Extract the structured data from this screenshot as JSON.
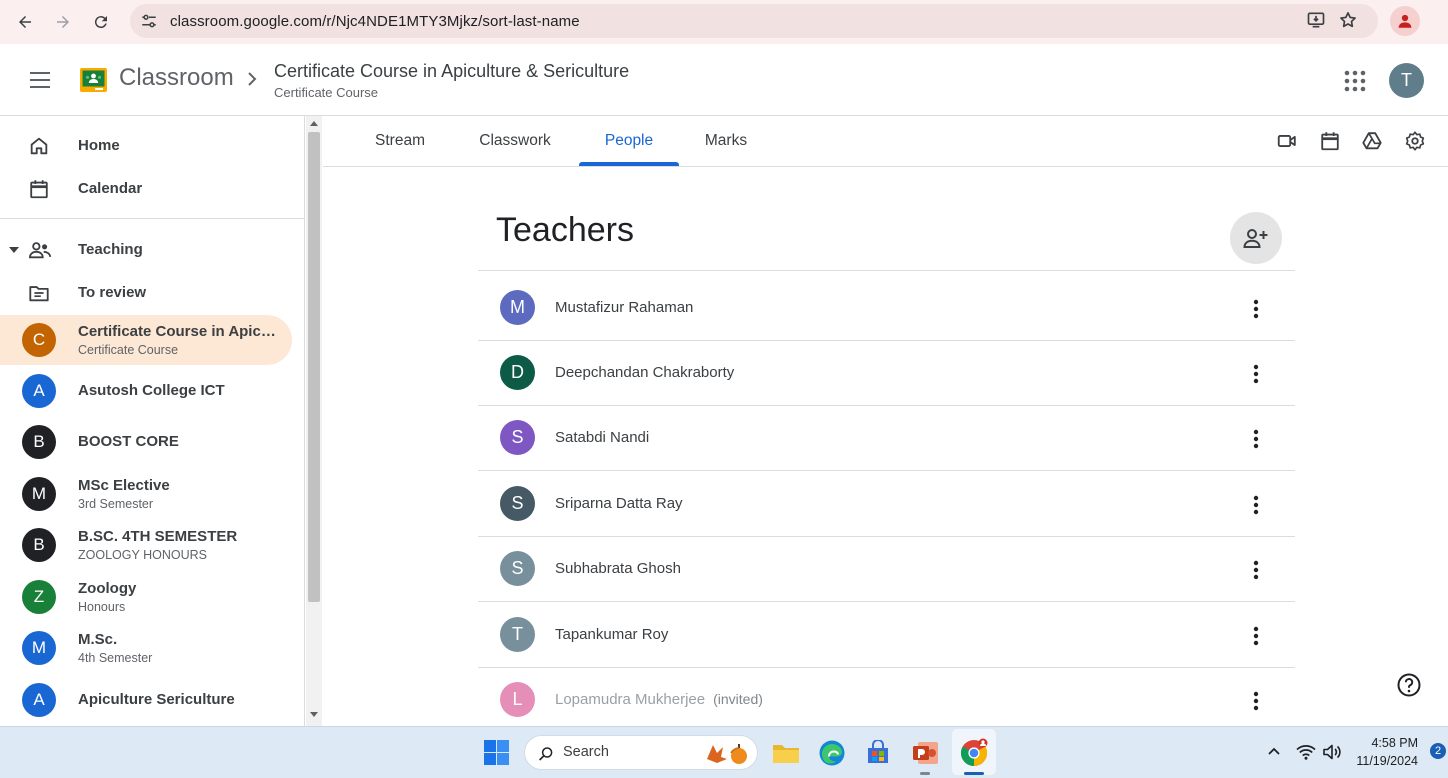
{
  "browser": {
    "url": "classroom.google.com/r/Njc4NDE1MTY3Mjkz/sort-last-name"
  },
  "header": {
    "brand": "Classroom",
    "course_title": "Certificate Course in Apiculture & Sericulture",
    "course_subtitle": "Certificate Course",
    "user_initial": "T"
  },
  "sidebar": {
    "home": "Home",
    "calendar": "Calendar",
    "teaching": "Teaching",
    "to_review": "To review",
    "courses": [
      {
        "initial": "C",
        "name": "Certificate Course in Apiculture & Sericulture",
        "sub": "Certificate Course",
        "color": "#c26401"
      },
      {
        "initial": "A",
        "name": "Asutosh College ICT",
        "sub": "",
        "color": "#1967d2"
      },
      {
        "initial": "B",
        "name": "BOOST CORE",
        "sub": "",
        "color": "#202124"
      },
      {
        "initial": "M",
        "name": "MSc Elective",
        "sub": "3rd Semester",
        "color": "#202124"
      },
      {
        "initial": "B",
        "name": "B.SC. 4TH SEMESTER",
        "sub": "ZOOLOGY HONOURS",
        "color": "#202124"
      },
      {
        "initial": "Z",
        "name": "Zoology",
        "sub": "Honours",
        "color": "#188038"
      },
      {
        "initial": "M",
        "name": "M.Sc.",
        "sub": "4th Semester",
        "color": "#1967d2"
      },
      {
        "initial": "A",
        "name": "Apiculture Sericulture",
        "sub": "",
        "color": "#1967d2"
      }
    ]
  },
  "tabs": [
    "Stream",
    "Classwork",
    "People",
    "Marks"
  ],
  "active_tab": "People",
  "teachers": {
    "title": "Teachers",
    "list": [
      {
        "initial": "M",
        "name": "Mustafizur Rahaman",
        "color": "#5c6bc0"
      },
      {
        "initial": "D",
        "name": "Deepchandan Chakraborty",
        "color": "#0d5a46"
      },
      {
        "initial": "S",
        "name": "Satabdi Nandi",
        "color": "#7e57c2"
      },
      {
        "initial": "S",
        "name": "Sriparna Datta Ray",
        "color": "#455a64"
      },
      {
        "initial": "S",
        "name": "Subhabrata Ghosh",
        "color": "#78909c"
      },
      {
        "initial": "T",
        "name": "Tapankumar Roy",
        "color": "#78909c"
      },
      {
        "initial": "L",
        "name": "Lopamudra Mukherjee",
        "color": "#e58fb8",
        "status": "(invited)"
      }
    ]
  },
  "taskbar": {
    "search": "Search",
    "time": "4:58 PM",
    "date": "11/19/2024",
    "notifications": "2"
  }
}
